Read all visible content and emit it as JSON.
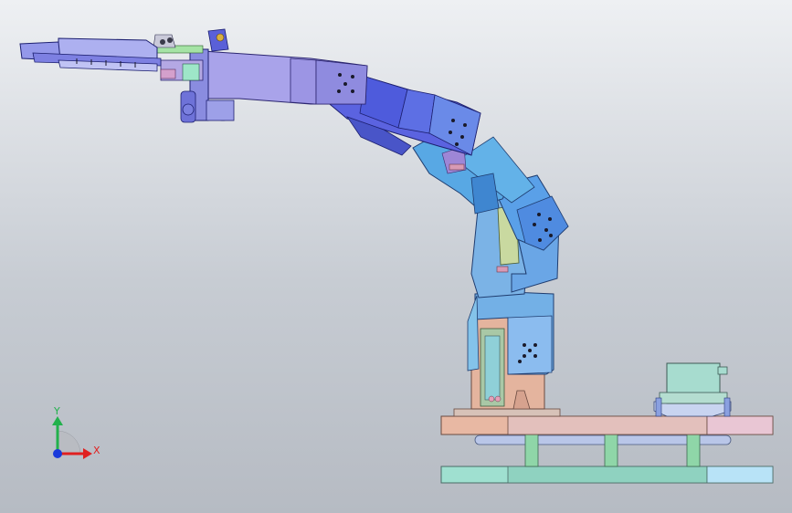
{
  "view": {
    "background_top": "#eef0f3",
    "background_bottom": "#b6bbc3"
  },
  "triad": {
    "y_label": "Y",
    "x_label": "X",
    "y_color": "#22b14c",
    "x_color": "#e02020",
    "z_color": "#1a3adb"
  },
  "model": {
    "parts": [
      "gripper-jaw",
      "wrist-servo",
      "upper-arm-link",
      "elbow-joint",
      "forearm-link",
      "shoulder-link",
      "base-servo-mount",
      "base-plate",
      "support-pillars",
      "bottom-plate",
      "rotation-servo"
    ],
    "colors": {
      "arm_lavender": "#a9a3ea",
      "arm_blue": "#5a63e0",
      "arm_sky": "#6fb4ea",
      "arm_cyan": "#8ed4ee",
      "base_salmon": "#e8b8a3",
      "base_pink": "#d9b6c2",
      "base_teal": "#9fe0d0",
      "servo_teal": "#a7dccf"
    }
  }
}
